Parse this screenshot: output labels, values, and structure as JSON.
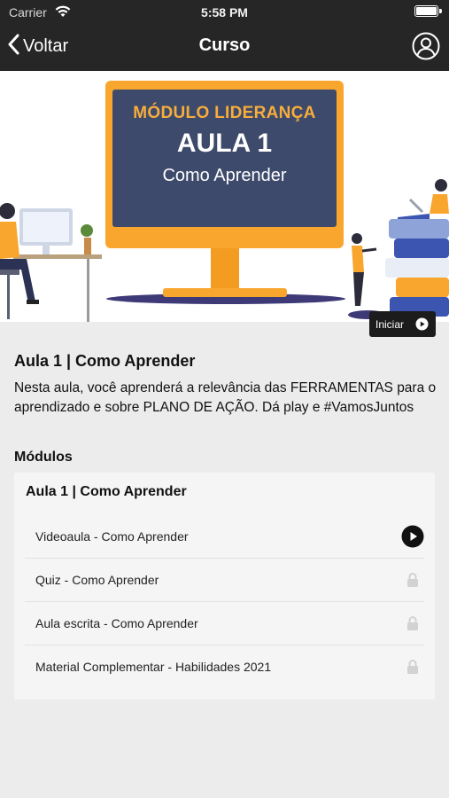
{
  "status_bar": {
    "carrier": "Carrier",
    "time": "5:58 PM"
  },
  "nav": {
    "back_label": "Voltar",
    "title": "Curso"
  },
  "banner": {
    "line1": "MÓDULO LIDERANÇA",
    "line2": "AULA 1",
    "line3": "Como Aprender",
    "start_label": "Iniciar"
  },
  "lesson": {
    "title": "Aula 1 | Como Aprender",
    "description": "Nesta aula, você aprenderá a relevância das FERRAMENTAS para o aprendizado e sobre PLANO DE AÇÃO. Dá play e #VamosJuntos"
  },
  "modules": {
    "heading": "Módulos",
    "card_title": "Aula 1 | Como Aprender",
    "items": [
      {
        "label": "Videoaula - Como Aprender",
        "icon": "play-icon"
      },
      {
        "label": "Quiz - Como Aprender",
        "icon": "lock-icon"
      },
      {
        "label": "Aula escrita - Como Aprender",
        "icon": "lock-icon"
      },
      {
        "label": "Material Complementar - Habilidades 2021",
        "icon": "lock-icon"
      }
    ]
  },
  "colors": {
    "nav_background": "#262626",
    "monitor_orange": "#f8a62e",
    "screen_navy": "#3d4a6b",
    "page_background": "#ececec"
  }
}
